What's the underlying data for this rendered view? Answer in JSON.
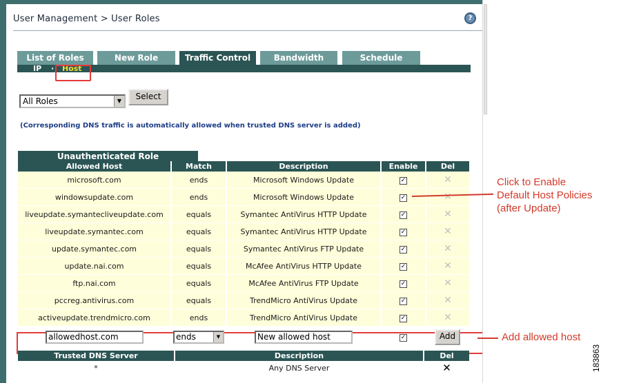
{
  "header": {
    "breadcrumb": "User Management > User Roles",
    "help_icon": "help-icon"
  },
  "tabs": [
    {
      "label": "List of Roles"
    },
    {
      "label": "New Role"
    },
    {
      "label": "Traffic Control"
    },
    {
      "label": "Bandwidth"
    },
    {
      "label": "Schedule"
    }
  ],
  "subnav": {
    "ip": "IP",
    "separator": "·",
    "host": "Host"
  },
  "role_filter": {
    "selected": "All Roles",
    "select_label": "Select"
  },
  "dns_note": "(Corresponding DNS traffic is automatically allowed when trusted DNS server is added)",
  "role_section": {
    "title": "Unauthenticated Role"
  },
  "hosts_table": {
    "headers": [
      "Allowed Host",
      "Match",
      "Description",
      "Enable",
      "Del"
    ],
    "rows": [
      {
        "host": "microsoft.com",
        "match": "ends",
        "description": "Microsoft Windows Update",
        "enabled": true
      },
      {
        "host": "windowsupdate.com",
        "match": "ends",
        "description": "Microsoft Windows Update",
        "enabled": true
      },
      {
        "host": "liveupdate.symantecliveupdate.com",
        "match": "equals",
        "description": "Symantec AntiVirus HTTP Update",
        "enabled": true
      },
      {
        "host": "liveupdate.symantec.com",
        "match": "equals",
        "description": "Symantec AntiVirus HTTP Update",
        "enabled": true
      },
      {
        "host": "update.symantec.com",
        "match": "equals",
        "description": "Symantec AntiVirus FTP Update",
        "enabled": true
      },
      {
        "host": "update.nai.com",
        "match": "equals",
        "description": "McAfee AntiVirus HTTP Update",
        "enabled": true
      },
      {
        "host": "ftp.nai.com",
        "match": "equals",
        "description": "McAfee AntiVirus FTP Update",
        "enabled": true
      },
      {
        "host": "pccreg.antivirus.com",
        "match": "equals",
        "description": "TrendMicro AntiVirus Update",
        "enabled": true
      },
      {
        "host": "activeupdate.trendmicro.com",
        "match": "ends",
        "description": "TrendMicro AntiVirus Update",
        "enabled": true
      }
    ]
  },
  "add_row": {
    "host_value": "allowedhost.com",
    "match_value": "ends",
    "description_value": "New allowed host",
    "add_label": "Add",
    "enabled": true
  },
  "dns_table": {
    "headers": [
      "Trusted DNS Server",
      "Description",
      "Del"
    ],
    "rows": [
      {
        "server": "*",
        "description": "Any DNS Server"
      }
    ]
  },
  "annotations": {
    "enable_note": [
      "Click to Enable",
      "Default Host Policies",
      "(after Update)"
    ],
    "add_note": "Add allowed host"
  },
  "figure_number": "183863",
  "colors": {
    "teal_dark": "#2b5554",
    "teal_light": "#6d9b9a",
    "row_bg": "#fefeda",
    "annotation": "#d23a2a"
  }
}
